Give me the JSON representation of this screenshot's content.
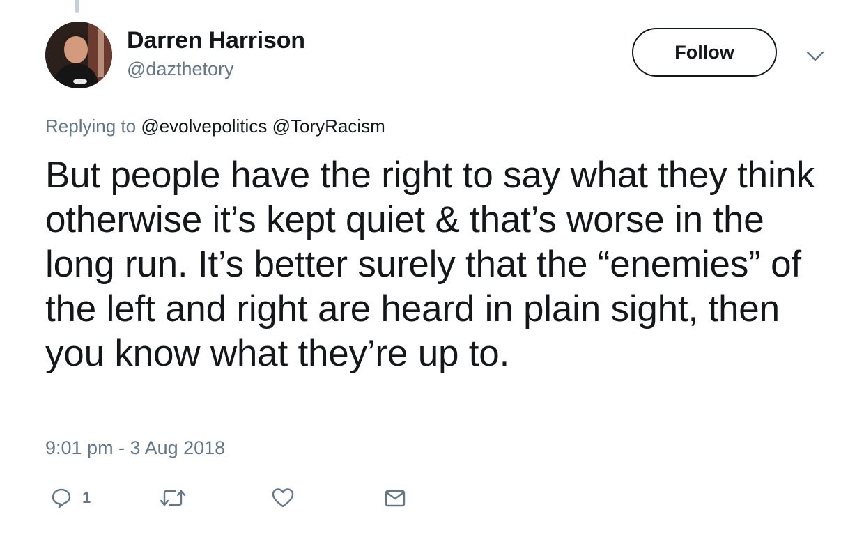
{
  "tweet": {
    "author": {
      "display_name": "Darren Harrison",
      "handle": "@dazthetory"
    },
    "follow_label": "Follow",
    "replying_prefix": "Replying to",
    "replying_mentions": [
      "@evolvepolitics",
      "@ToryRacism"
    ],
    "text": "But people have the right to say what they think otherwise it’s kept quiet & that’s worse in the long run. It’s better surely that the “enemies” of the left and right are heard in plain sight, then you know what they’re up to.",
    "timestamp": "9:01 pm - 3 Aug 2018",
    "actions": {
      "reply_count": "1"
    }
  },
  "icons": {
    "caret": "chevron-down-icon",
    "reply": "reply-icon",
    "retweet": "retweet-icon",
    "like": "heart-icon",
    "dm": "envelope-icon"
  },
  "colors": {
    "text": "#14171a",
    "secondary": "#657786",
    "thread_line": "#c4cfd6"
  }
}
